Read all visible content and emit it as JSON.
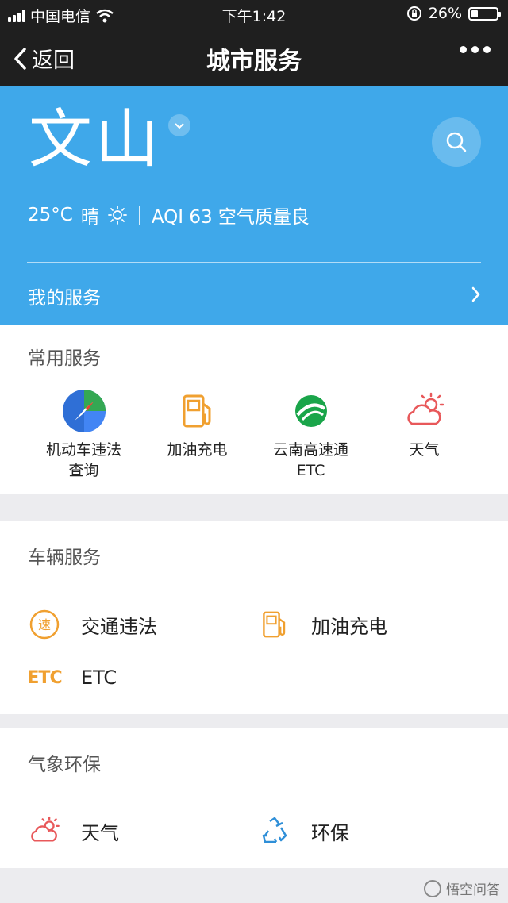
{
  "status_bar": {
    "carrier": "中国电信",
    "time": "下午1:42",
    "battery": "26%",
    "battery_level": 0.26
  },
  "nav": {
    "back_label": "返回",
    "title": "城市服务"
  },
  "header": {
    "city": "文山",
    "temperature": "25°C",
    "weather": "晴",
    "aqi": "AQI 63 空气质量良",
    "my_services": "我的服务",
    "accent_color": "#3fa8ea"
  },
  "common_services": {
    "title": "常用服务",
    "items": [
      {
        "label": "机动车违法\n查询",
        "icon": "compass-icon"
      },
      {
        "label": "加油充电",
        "icon": "fuel-pump-icon"
      },
      {
        "label": "云南高速通\nETC",
        "icon": "highway-logo-icon"
      },
      {
        "label": "天气",
        "icon": "cloud-sun-icon"
      }
    ]
  },
  "vehicle_services": {
    "title": "车辆服务",
    "items": [
      {
        "label": "交通违法",
        "icon": "violation-icon"
      },
      {
        "label": "加油充电",
        "icon": "fuel-pump-icon"
      },
      {
        "label": "ETC",
        "icon": "etc-icon"
      }
    ],
    "etc_icon_text": "ETC"
  },
  "weather_env": {
    "title": "气象环保",
    "items": [
      {
        "label": "天气",
        "icon": "cloud-sun-icon"
      },
      {
        "label": "环保",
        "icon": "recycle-icon"
      }
    ]
  },
  "watermark": "悟空问答"
}
